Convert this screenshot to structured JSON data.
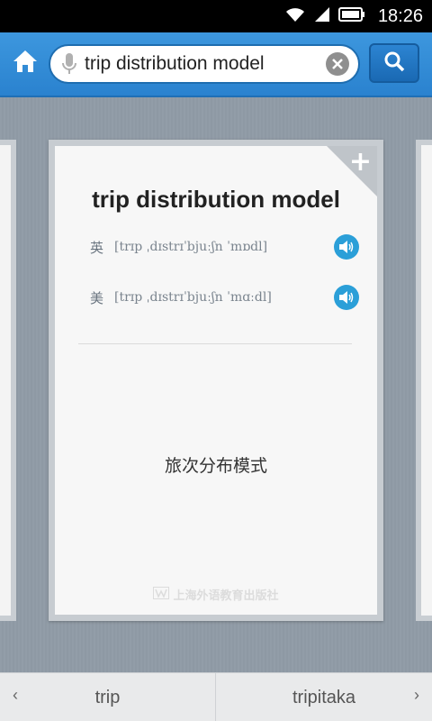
{
  "status_bar": {
    "time": "18:26"
  },
  "header": {
    "search": {
      "value": "trip distribution model"
    }
  },
  "card": {
    "word": "trip distribution model",
    "pronunciations": [
      {
        "label": "英",
        "ipa": "[trɪp ˌdɪstrɪˈbjuːʃn ˈmɒdl]"
      },
      {
        "label": "美",
        "ipa": "[trɪp ˌdɪstrɪˈbjuːʃn ˈmɑːdl]"
      }
    ],
    "translation": "旅次分布模式",
    "publisher": "上海外语教育出版社"
  },
  "bottom_nav": {
    "prev": "trip",
    "next": "tripitaka"
  },
  "colors": {
    "header_blue": "#2a82cf",
    "speaker_blue": "#2b9fd8",
    "background": "#8e99a4"
  }
}
